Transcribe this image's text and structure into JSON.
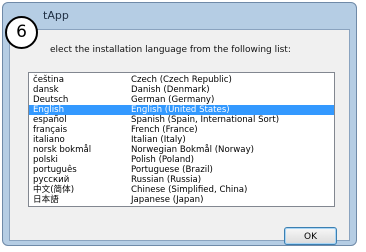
{
  "window": {
    "title": "Setup - App",
    "title_visible_fragment": "tApp"
  },
  "dialog": {
    "prompt": "elect the installation language from the following list:",
    "ok_label": "OK"
  },
  "languages": [
    {
      "native": "čeština",
      "english": "Czech (Czech Republic)",
      "selected": false
    },
    {
      "native": "dansk",
      "english": "Danish (Denmark)",
      "selected": false
    },
    {
      "native": "Deutsch",
      "english": "German (Germany)",
      "selected": false
    },
    {
      "native": "English",
      "english": "English (United States)",
      "selected": true
    },
    {
      "native": "español",
      "english": "Spanish (Spain, International Sort)",
      "selected": false
    },
    {
      "native": "français",
      "english": "French (France)",
      "selected": false
    },
    {
      "native": "italiano",
      "english": "Italian (Italy)",
      "selected": false
    },
    {
      "native": "norsk bokmål",
      "english": "Norwegian Bokmål (Norway)",
      "selected": false
    },
    {
      "native": "polski",
      "english": "Polish (Poland)",
      "selected": false
    },
    {
      "native": "português",
      "english": "Portuguese (Brazil)",
      "selected": false
    },
    {
      "native": "русский",
      "english": "Russian (Russia)",
      "selected": false
    },
    {
      "native": "中文(简体)",
      "english": "Chinese (Simplified, China)",
      "selected": false
    },
    {
      "native": "日本語",
      "english": "Japanese (Japan)",
      "selected": false
    }
  ],
  "annotation": {
    "step_number": "6"
  },
  "colors": {
    "selection": "#3399ff",
    "dialog_frame": "#b5cde4",
    "client_background": "#f0f0f0"
  }
}
